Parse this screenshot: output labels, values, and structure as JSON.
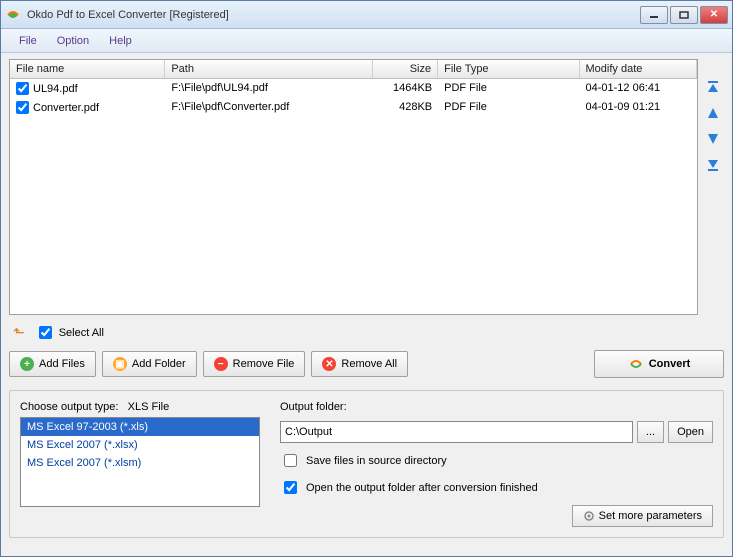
{
  "title": "Okdo Pdf to Excel Converter [Registered]",
  "menu": {
    "file": "File",
    "option": "Option",
    "help": "Help"
  },
  "table": {
    "headers": {
      "name": "File name",
      "path": "Path",
      "size": "Size",
      "type": "File Type",
      "date": "Modify date"
    },
    "rows": [
      {
        "checked": true,
        "name": "UL94.pdf",
        "path": "F:\\File\\pdf\\UL94.pdf",
        "size": "1464KB",
        "type": "PDF File",
        "date": "04-01-12 06:41"
      },
      {
        "checked": true,
        "name": "Converter.pdf",
        "path": "F:\\File\\pdf\\Converter.pdf",
        "size": "428KB",
        "type": "PDF File",
        "date": "04-01-09 01:21"
      }
    ]
  },
  "selectAll": {
    "label": "Select All",
    "checked": true
  },
  "buttons": {
    "addFiles": "Add Files",
    "addFolder": "Add Folder",
    "removeFile": "Remove File",
    "removeAll": "Remove All",
    "convert": "Convert"
  },
  "outputType": {
    "label": "Choose output type:",
    "current": "XLS File",
    "options": [
      "MS Excel 97-2003 (*.xls)",
      "MS Excel 2007 (*.xlsx)",
      "MS Excel 2007 (*.xlsm)"
    ],
    "selectedIndex": 0
  },
  "outputFolder": {
    "label": "Output folder:",
    "value": "C:\\Output",
    "browse": "...",
    "open": "Open"
  },
  "options": {
    "saveInSource": {
      "label": "Save files in source directory",
      "checked": false
    },
    "openAfter": {
      "label": "Open the output folder after conversion finished",
      "checked": true
    }
  },
  "moreParams": "Set more parameters"
}
